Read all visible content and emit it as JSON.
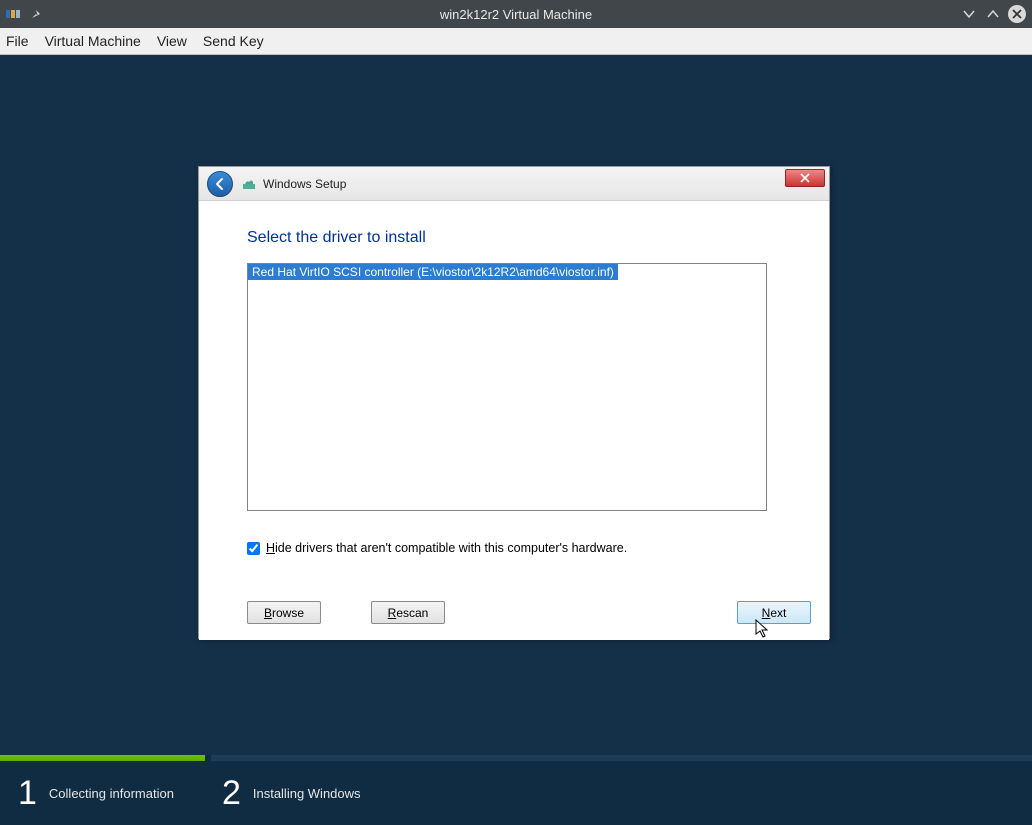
{
  "window": {
    "title": "win2k12r2 Virtual Machine"
  },
  "menubar": {
    "file": "File",
    "vm": "Virtual Machine",
    "view": "View",
    "send_key": "Send Key"
  },
  "dialog": {
    "title": "Windows Setup",
    "heading": "Select the driver to install",
    "drivers": [
      "Red Hat VirtIO SCSI controller (E:\\viostor\\2k12R2\\amd64\\viostor.inf)"
    ],
    "hide_checkbox_prefix_letter": "H",
    "hide_checkbox_rest": "ide drivers that aren't compatible with this computer's hardware.",
    "hide_checked": true,
    "browse_prefix": "B",
    "browse_rest": "rowse",
    "rescan_prefix": "R",
    "rescan_rest": "escan",
    "next_prefix": "N",
    "next_rest": "ext"
  },
  "steps": {
    "step1_num": "1",
    "step1_label": "Collecting information",
    "step2_num": "2",
    "step2_label": "Installing Windows"
  }
}
